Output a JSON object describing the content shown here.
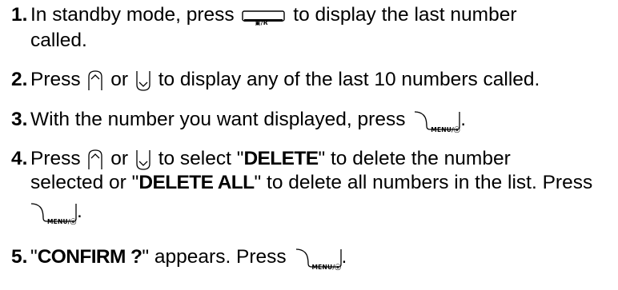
{
  "steps": [
    {
      "number": "1.",
      "line1_before": "In standby mode, press",
      "line1_after": "to display the last number",
      "line2": "called."
    },
    {
      "number": "2.",
      "before": "Press",
      "middle": "or",
      "after": "to display any of the last 10 numbers called."
    },
    {
      "number": "3.",
      "before": "With the number you want displayed, press",
      "after": "."
    },
    {
      "number": "4.",
      "line1_before": "Press",
      "line1_middle": "or",
      "line1_after_a": "to select \"",
      "keyword1": "DELETE",
      "line1_after_b": "\" to delete the number",
      "line2_a": "selected or \"",
      "keyword2": "DELETE ALL",
      "line2_b": "\" to delete all numbers in the list. Press",
      "line3_after": "."
    },
    {
      "number": "5.",
      "quote_open": "\"",
      "keyword": "CONFIRM ?",
      "after": "\" appears. Press",
      "end": "."
    }
  ],
  "keys": {
    "redial_label": "▣/R",
    "menu_label": "MENU/ⓞ"
  },
  "icons": [
    "redial-key-icon",
    "up-arrow-key-icon",
    "down-arrow-key-icon",
    "menu-key-icon"
  ]
}
